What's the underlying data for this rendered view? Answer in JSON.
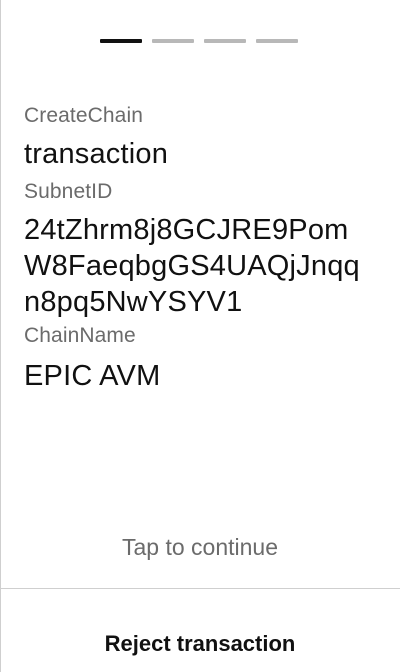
{
  "stepper": {
    "total_steps": 4,
    "current_step": 1
  },
  "fields": [
    {
      "label": "CreateChain",
      "value": "transaction"
    },
    {
      "label": "SubnetID",
      "value": "24tZhrm8j8GCJRE9PomW8FaeqbgGS4UAQjJnqqn8pq5NwYSYV1"
    },
    {
      "label": "ChainName",
      "value": "EPIC AVM"
    }
  ],
  "actions": {
    "tap_continue": "Tap to continue",
    "reject_label": "Reject transaction"
  },
  "colors": {
    "text_primary": "#111111",
    "text_secondary": "#6b6b6b",
    "step_inactive": "#b8b8b8",
    "divider": "#cfcfcf"
  }
}
